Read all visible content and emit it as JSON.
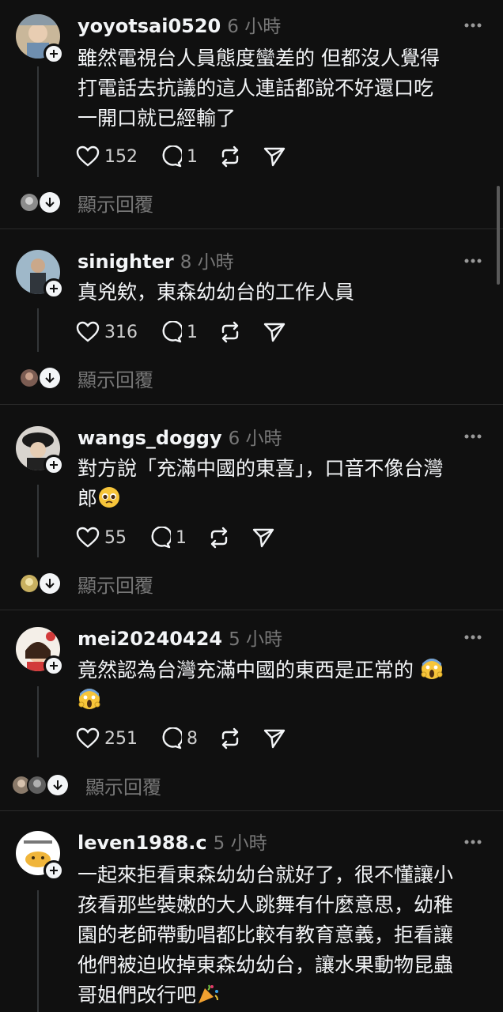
{
  "posts": [
    {
      "username": "yoyotsai0520",
      "time": "6 小時",
      "text": "雖然電視台人員態度蠻差的 但都沒人覺得\n打電話去抗議的這人連話都說不好還口吃\n一開口就已經輸了",
      "likes": "152",
      "comments": "1",
      "show_replies": "顯示回覆"
    },
    {
      "username": "sinighter",
      "time": "8 小時",
      "text": "真兇欸，東森幼幼台的工作人員",
      "likes": "316",
      "comments": "1",
      "show_replies": "顯示回覆"
    },
    {
      "username": "wangs_doggy",
      "time": "6 小時",
      "text": "對方說「充滿中國的東喜」，口音不像台灣\n郎",
      "likes": "55",
      "comments": "1",
      "show_replies": "顯示回覆"
    },
    {
      "username": "mei20240424",
      "time": "5 小時",
      "text": "竟然認為台灣充滿中國的東西是正常的",
      "likes": "251",
      "comments": "8",
      "show_replies": "顯示回覆"
    },
    {
      "username": "leven1988.c",
      "time": "5 小時",
      "text": "一起來拒看東森幼幼台就好了，很不懂讓小\n孩看那些裝嫩的大人跳舞有什麼意思，幼稚\n園的老師帶動唱都比較有教育意義，拒看讓\n他們被迫收掉東森幼幼台，讓水果動物昆蟲\n哥姐們改行吧"
    }
  ],
  "colors": {
    "background": "#101010",
    "text": "#f3f5f7",
    "muted": "#777777"
  }
}
